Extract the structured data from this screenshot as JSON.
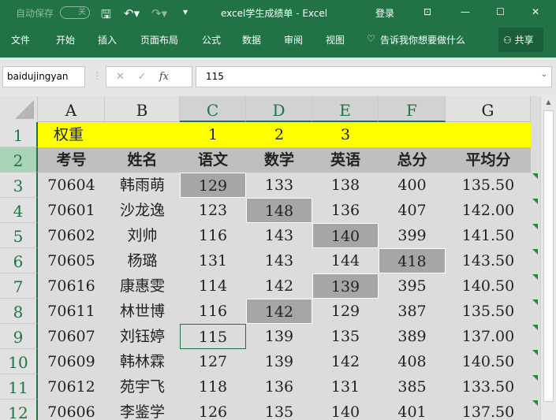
{
  "titlebar": {
    "autosave": "自动保存",
    "autosave_state": "关",
    "title": "excel学生成绩单 - Excel",
    "login": "登录"
  },
  "ribbon": {
    "tabs": [
      "文件",
      "开始",
      "插入",
      "页面布局",
      "公式",
      "数据",
      "审阅",
      "视图"
    ],
    "tell_me": "告诉我你想要做什么",
    "share": "共享"
  },
  "formula_bar": {
    "name_box": "baidujingyan",
    "value": "115",
    "fx": "fx"
  },
  "columns": [
    "A",
    "B",
    "C",
    "D",
    "E",
    "F",
    "G"
  ],
  "rows": [
    [
      "权重",
      "",
      "1",
      "2",
      "3",
      "",
      ""
    ],
    [
      "考号",
      "姓名",
      "语文",
      "数学",
      "英语",
      "总分",
      "平均分"
    ],
    [
      "70604",
      "韩雨萌",
      "129",
      "133",
      "138",
      "400",
      "135.50"
    ],
    [
      "70601",
      "沙龙逸",
      "123",
      "148",
      "136",
      "407",
      "142.00"
    ],
    [
      "70602",
      "刘帅",
      "116",
      "143",
      "140",
      "399",
      "141.50"
    ],
    [
      "70605",
      "杨璐",
      "131",
      "143",
      "144",
      "418",
      "143.50"
    ],
    [
      "70616",
      "康惠雯",
      "114",
      "142",
      "139",
      "395",
      "140.50"
    ],
    [
      "70611",
      "林世博",
      "116",
      "142",
      "129",
      "387",
      "135.50"
    ],
    [
      "70607",
      "刘钰婷",
      "115",
      "139",
      "135",
      "389",
      "137.00"
    ],
    [
      "70609",
      "韩林霖",
      "127",
      "139",
      "142",
      "408",
      "140.50"
    ],
    [
      "70612",
      "苑宇飞",
      "118",
      "136",
      "131",
      "385",
      "133.50"
    ],
    [
      "70606",
      "李鉴学",
      "126",
      "135",
      "140",
      "401",
      "137.50"
    ]
  ],
  "highlighted": [
    [
      3,
      2
    ],
    [
      4,
      3
    ],
    [
      5,
      4
    ],
    [
      6,
      5
    ],
    [
      7,
      4
    ],
    [
      8,
      3
    ]
  ],
  "active_cell": [
    9,
    2
  ],
  "colors": {
    "accent": "#217346",
    "highlight": "#a6a6a6",
    "weight_row": "#ffff00"
  }
}
